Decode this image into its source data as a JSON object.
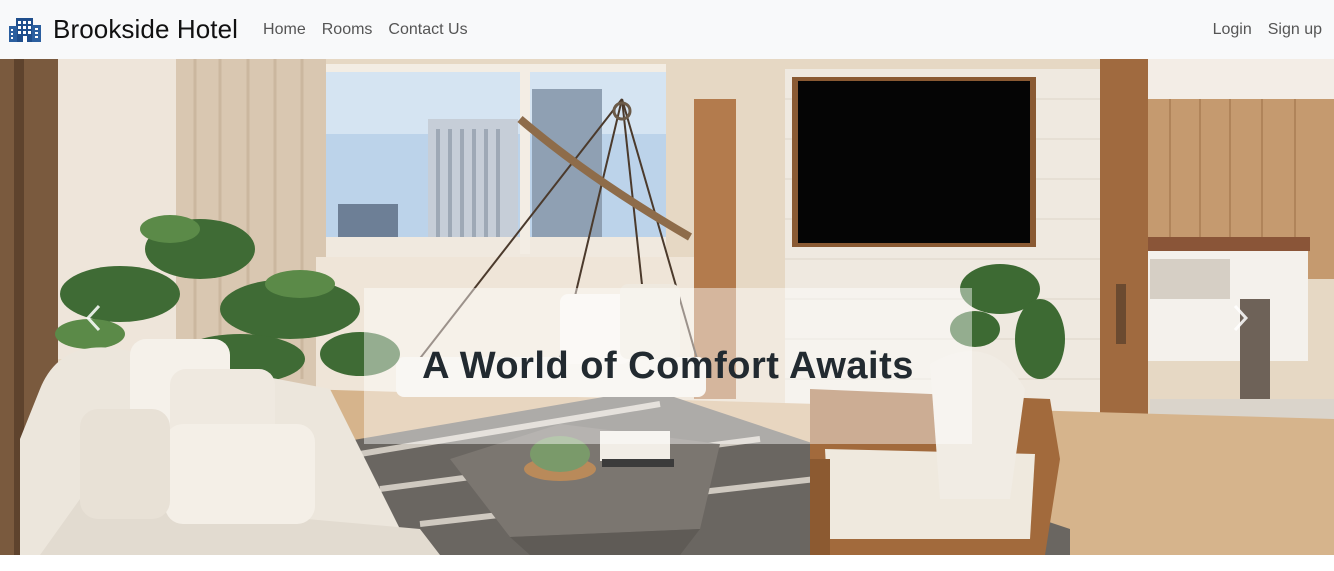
{
  "navbar": {
    "brand": "Brookside Hotel",
    "brand_icon": "hotel-building-icon",
    "links": [
      "Home",
      "Rooms",
      "Contact Us"
    ],
    "right_links": [
      "Login",
      "Sign up"
    ]
  },
  "hero": {
    "caption": "A World of Comfort Awaits",
    "prev_icon": "chevron-left-icon",
    "next_icon": "chevron-right-icon"
  },
  "colors": {
    "navbar_bg": "#f8f9fa",
    "brand_icon": "#1f4e8c",
    "caption_text": "#222a30"
  }
}
